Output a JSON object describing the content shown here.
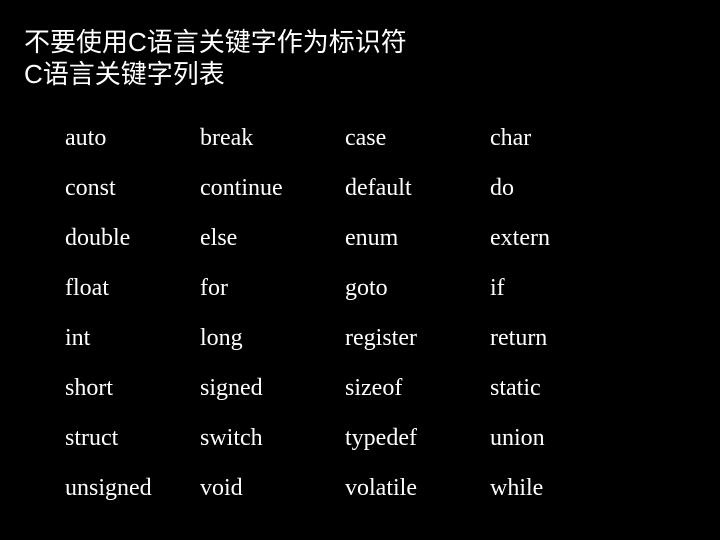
{
  "slide": {
    "background_color": "#000000",
    "text_color": "#ffffff",
    "title": {
      "line1": "不要使用C语言关键字作为标识符",
      "line2": "C语言关键字列表"
    },
    "keyword_table": {
      "rows": [
        [
          "auto",
          "break",
          "case",
          "char"
        ],
        [
          "const",
          "continue",
          "default",
          "do"
        ],
        [
          "double",
          "else",
          "enum",
          "extern"
        ],
        [
          "float",
          "for",
          "goto",
          "if"
        ],
        [
          "int",
          "long",
          "register",
          "return"
        ],
        [
          "short",
          "signed",
          "sizeof",
          "static"
        ],
        [
          "struct",
          "switch",
          "typedef",
          "union"
        ],
        [
          "unsigned",
          "void",
          "volatile",
          "while"
        ]
      ]
    }
  }
}
